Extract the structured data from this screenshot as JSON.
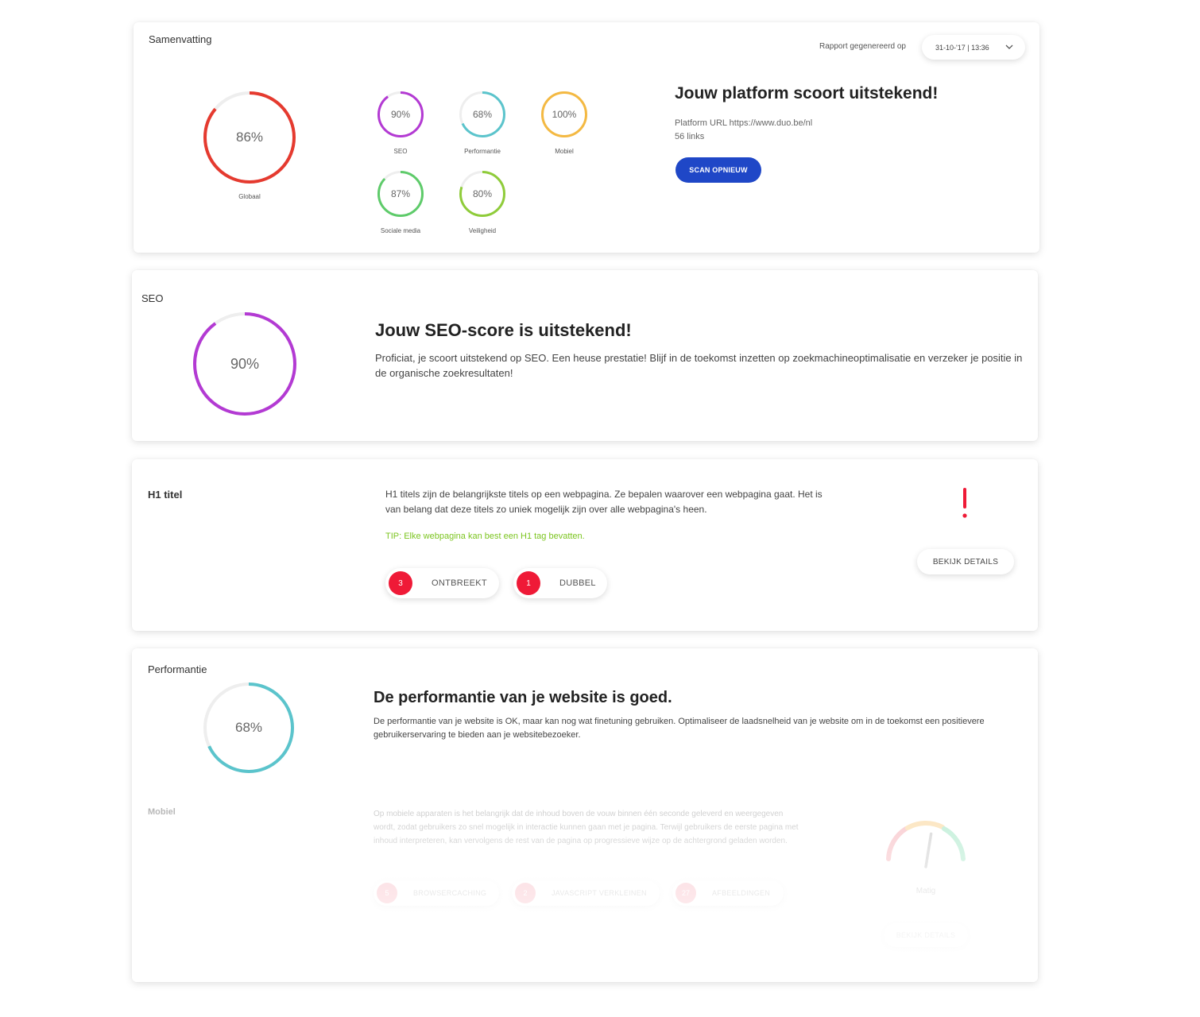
{
  "summary": {
    "title": "Samenvatting",
    "report_label": "Rapport gegenereerd op",
    "report_date": "31-10-'17 | 13:36",
    "global": {
      "value": "86%",
      "label": "Globaal",
      "fraction": 0.86,
      "color": "#e53a2f"
    },
    "scores": [
      {
        "value": "90%",
        "label": "SEO",
        "fraction": 0.9,
        "color": "#b33ad3"
      },
      {
        "value": "68%",
        "label": "Performantie",
        "fraction": 0.68,
        "color": "#5bc4cc"
      },
      {
        "value": "100%",
        "label": "Mobiel",
        "fraction": 1.0,
        "color": "#f4b942"
      },
      {
        "value": "87%",
        "label": "Sociale media",
        "fraction": 0.87,
        "color": "#5ecb6a"
      },
      {
        "value": "80%",
        "label": "Veiligheid",
        "fraction": 0.8,
        "color": "#8fcc3a"
      }
    ],
    "headline": "Jouw platform scoort uitstekend!",
    "platform_url": "Platform URL https://www.duo.be/nl",
    "links": "56 links",
    "scan_button": "SCAN OPNIEUW"
  },
  "seo": {
    "title": "SEO",
    "ring": {
      "value": "90%",
      "fraction": 0.9,
      "color": "#b33ad3"
    },
    "headline": "Jouw SEO-score is uitstekend!",
    "text": "Proficiat, je scoort uitstekend op SEO. Een heuse prestatie! Blijf in de toekomst inzetten op zoekmachineoptimalisatie en verzeker je positie in de organische zoekresultaten!"
  },
  "h1": {
    "title": "H1 titel",
    "text": "H1 titels zijn de belangrijkste titels op een webpagina. Ze bepalen waarover een webpagina gaat. Het is van belang dat deze titels zo uniek mogelijk zijn over alle webpagina's heen.",
    "tip": "TIP: Elke webpagina kan best een H1 tag bevatten.",
    "pills": [
      {
        "count": "3",
        "label": "ONTBREEKT"
      },
      {
        "count": "1",
        "label": "DUBBEL"
      }
    ],
    "details_button": "BEKIJK DETAILS",
    "warning_color": "#ef1a37"
  },
  "performance": {
    "title": "Performantie",
    "ring": {
      "value": "68%",
      "fraction": 0.68,
      "color": "#5bc4cc"
    },
    "headline": "De performantie van je website is goed.",
    "text": "De performantie van je website is OK, maar kan nog wat finetuning gebruiken. Optimaliseer de laadsnelheid van je website om in de toekomst een positievere gebruikerservaring te bieden aan je websitebezoeker.",
    "mobile": {
      "title": "Mobiel",
      "text": "Op mobiele apparaten is het belangrijk dat de inhoud boven de vouw binnen één seconde geleverd en weergegeven wordt, zodat gebruikers zo snel mogelijk in interactie kunnen gaan met je pagina. Terwijl gebruikers de eerste pagina met inhoud interpreteren, kan vervolgens de rest van de pagina op progressieve wijze op de achtergrond geladen worden.",
      "pills": [
        {
          "count": "5",
          "label": "BROWSERCACHING"
        },
        {
          "count": "2",
          "label": "JAVASCRIPT VERKLEINEN"
        },
        {
          "count": "27",
          "label": "AFBEELDINGEN"
        }
      ],
      "gauge_label": "Matig",
      "gauge_level": 0.55,
      "details_button": "BEKIJK DETAILS"
    }
  }
}
